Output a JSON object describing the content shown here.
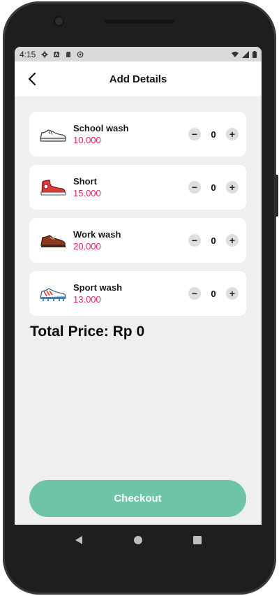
{
  "status_bar": {
    "time": "4:15"
  },
  "app_bar": {
    "title": "Add Details"
  },
  "items": [
    {
      "name": "School wash",
      "price": "10.000",
      "qty": "0",
      "icon": "white-sneaker-icon"
    },
    {
      "name": "Short",
      "price": "15.000",
      "qty": "0",
      "icon": "red-hightop-icon"
    },
    {
      "name": "Work wash",
      "price": "20.000",
      "qty": "0",
      "icon": "brown-boot-icon"
    },
    {
      "name": "Sport wash",
      "price": "13.000",
      "qty": "0",
      "icon": "cleat-icon"
    }
  ],
  "total_label": "Total Price: Rp 0",
  "checkout_label": "Checkout",
  "colors": {
    "accent": "#6ec4a7",
    "price": "#e0245e",
    "background": "#efefef"
  }
}
